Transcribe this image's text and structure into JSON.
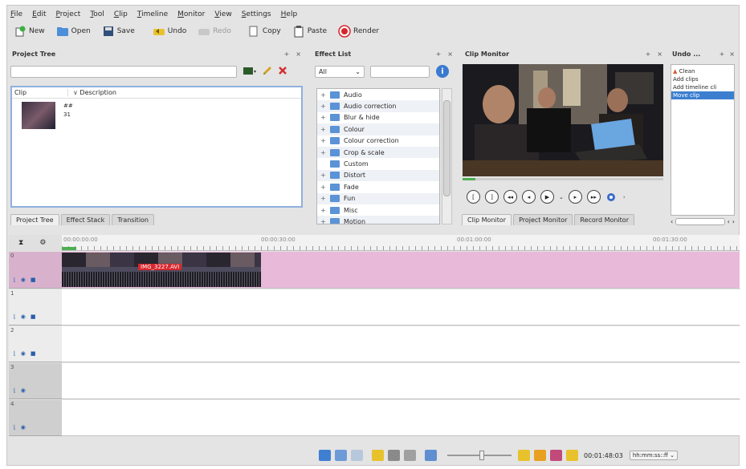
{
  "menu": [
    "File",
    "Edit",
    "Project",
    "Tool",
    "Clip",
    "Timeline",
    "Monitor",
    "View",
    "Settings",
    "Help"
  ],
  "toolbar": {
    "new": "New",
    "open": "Open",
    "save": "Save",
    "undo": "Undo",
    "redo": "Redo",
    "copy": "Copy",
    "paste": "Paste",
    "render": "Render"
  },
  "project_tree": {
    "title": "Project Tree",
    "col_clip": "Clip",
    "col_desc": "Description",
    "clip_line1": "##",
    "clip_line2": "31"
  },
  "left_tabs": [
    "Project Tree",
    "Effect Stack",
    "Transition"
  ],
  "effect_list": {
    "title": "Effect List",
    "filter": "All",
    "items": [
      "Audio",
      "Audio correction",
      "Blur & hide",
      "Colour",
      "Colour correction",
      "Crop & scale",
      "Custom",
      "Distort",
      "Fade",
      "Fun",
      "Misc",
      "Motion"
    ]
  },
  "clip_monitor": {
    "title": "Clip Monitor",
    "tabs": [
      "Clip Monitor",
      "Project Monitor",
      "Record Monitor"
    ]
  },
  "undo": {
    "title": "Undo ...",
    "items": [
      "Clean",
      "Add clips",
      "Add timeline cli",
      "Move clip"
    ]
  },
  "timeline": {
    "ruler": [
      "00:00:00:00",
      "00:00:30:00",
      "00:01:00:00",
      "00:01:30:00"
    ],
    "clip_label": "IMG_3227.AVI",
    "tracks": [
      "0",
      "1",
      "2",
      "3",
      "4"
    ]
  },
  "status": {
    "timecode": "00:01:48:03",
    "format": "hh:mm:ss::ff"
  },
  "colors": {
    "accent": "#3c7fd0",
    "timeline_track": "#e8b9d9",
    "clip_bg": "#4d4b5d",
    "render": "#d7262c"
  }
}
